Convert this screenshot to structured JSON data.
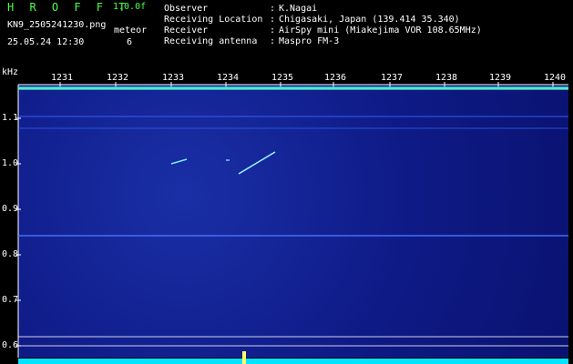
{
  "header": {
    "app_title": "H R O F F T",
    "app_version": "1.0.0f",
    "file_name": "KN9_2505241230.png",
    "meteor_label": "meteor",
    "meteor_count": "6",
    "datetime": "25.05.24 12:30"
  },
  "info": [
    {
      "label": "Observer",
      "sep": ":",
      "value": "K.Nagai"
    },
    {
      "label": "Receiving Location",
      "sep": ":",
      "value": "Chigasaki, Japan (139.414 35.340)"
    },
    {
      "label": "Receiver",
      "sep": ":",
      "value": "AirSpy mini (Miakejima VOR 108.65MHz)"
    },
    {
      "label": "Receiving antenna",
      "sep": ":",
      "value": "Maspro FM-3"
    }
  ],
  "spectrogram": {
    "y_unit": "kHz",
    "y_ticks": [
      "1.1",
      "1.0",
      "0.9",
      "0.8",
      "0.7",
      "0.6"
    ],
    "x_ticks": [
      "1231",
      "1232",
      "1233",
      "1234",
      "1235",
      "1236",
      "1237",
      "1238",
      "1239",
      "1240"
    ],
    "colors": {
      "background": "#0e1a86",
      "signal": "#00e5ff",
      "hot": "#ffff66",
      "bright": "#ffffff"
    }
  }
}
